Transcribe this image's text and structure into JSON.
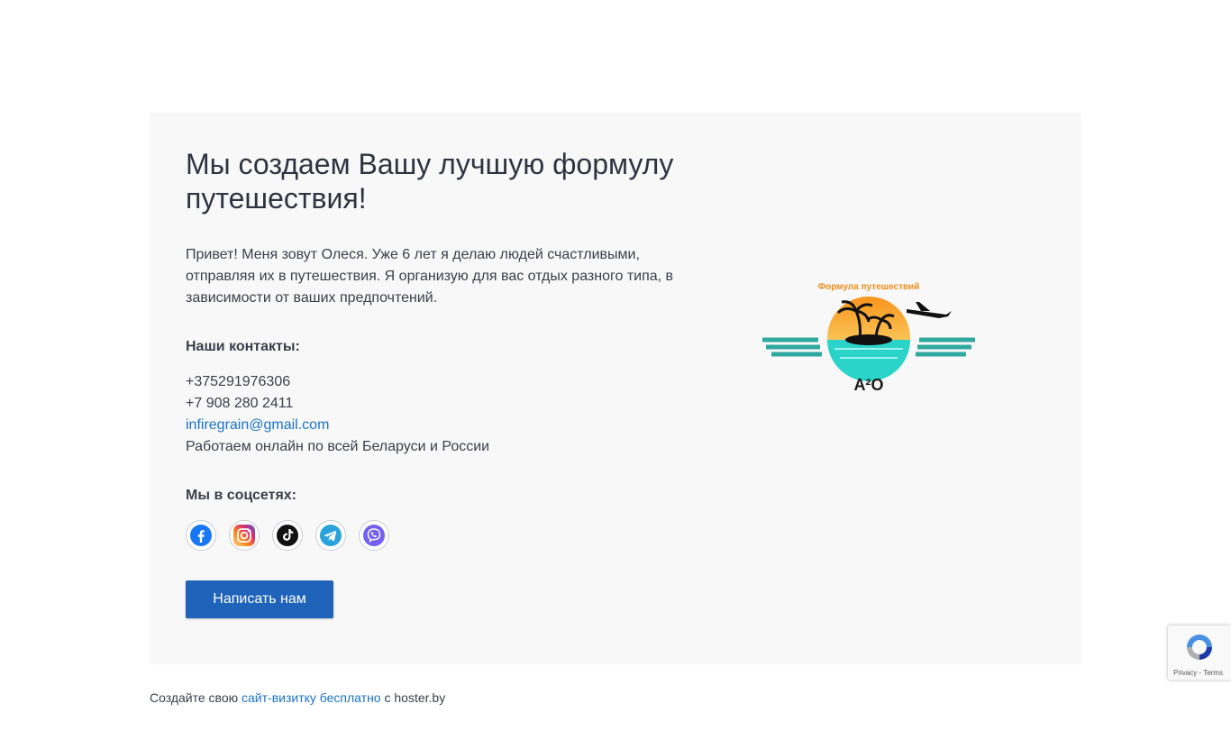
{
  "hero": {
    "title": "Мы создаем Вашу лучшую формулу путешествия!",
    "intro": "Привет! Меня зовут Олеся. Уже 6 лет я делаю людей счастливыми, отправляя их в путешествия. Я организую для вас отдых разного типа, в зависимости от ваших предпочтений."
  },
  "contacts": {
    "heading": "Наши контакты:",
    "phone1": "+375291976306",
    "phone2": "+7 908 280 2411",
    "email": "infiregrain@gmail.com",
    "note": "Работаем онлайн по всей Беларуси и России"
  },
  "social": {
    "heading": "Мы в соцсетях:",
    "icons": [
      "facebook-icon",
      "instagram-icon",
      "tiktok-icon",
      "telegram-icon",
      "viber-icon"
    ]
  },
  "cta": {
    "label": "Написать нам"
  },
  "logo": {
    "text": "Формула путешествий",
    "mark": "A²O"
  },
  "footer": {
    "prefix": "Создайте свою",
    "link": "сайт-визитку бесплатно",
    "suffix": "с hoster.by"
  },
  "recaptcha": {
    "links": "Privacy - Terms"
  },
  "colors": {
    "accent": "#1f63ba",
    "link": "#1a73c8",
    "card_bg": "#f8f8f8"
  }
}
